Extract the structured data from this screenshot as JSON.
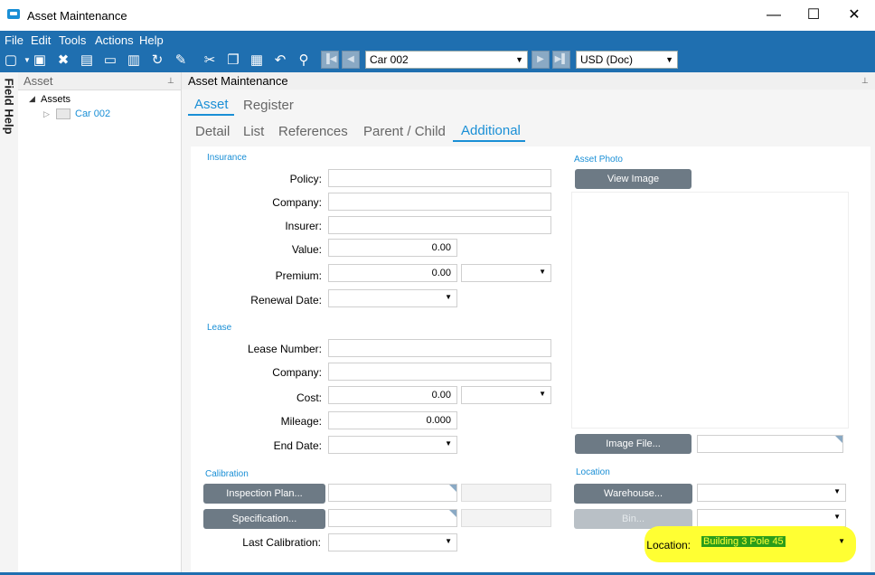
{
  "window": {
    "title": "Asset Maintenance",
    "minimize": "—",
    "maximize": "☐",
    "close": "✕"
  },
  "menu": [
    "File",
    "Edit",
    "Tools",
    "Actions",
    "Help"
  ],
  "toolbar": {
    "record_combo": "Car 002",
    "currency_combo": "USD (Doc)"
  },
  "sidebar": {
    "label": "Field Help"
  },
  "tree": {
    "header": "Asset",
    "root": "Assets",
    "child": "Car 002"
  },
  "main": {
    "header": "Asset Maintenance",
    "top_tabs": [
      "Asset",
      "Register"
    ],
    "sub_tabs": [
      "Detail",
      "List",
      "References",
      "Parent / Child",
      "Additional"
    ]
  },
  "insurance": {
    "section": "Insurance",
    "policy_label": "Policy:",
    "company_label": "Company:",
    "insurer_label": "Insurer:",
    "value_label": "Value:",
    "value": "0.00",
    "premium_label": "Premium:",
    "premium": "0.00",
    "renewal_label": "Renewal Date:"
  },
  "lease": {
    "section": "Lease",
    "number_label": "Lease Number:",
    "company_label": "Company:",
    "cost_label": "Cost:",
    "cost": "0.00",
    "mileage_label": "Mileage:",
    "mileage": "0.000",
    "end_label": "End Date:"
  },
  "calibration": {
    "section": "Calibration",
    "inspection_button": "Inspection Plan...",
    "specification_button": "Specification...",
    "last_label": "Last Calibration:"
  },
  "photo": {
    "section": "Asset Photo",
    "view_button": "View Image",
    "image_file_button": "Image File..."
  },
  "location": {
    "section": "Location",
    "warehouse_button": "Warehouse...",
    "bin_button": "Bin...",
    "location_label": "Location:",
    "location_value": "Building 3 Pole 45"
  },
  "colors": {
    "accent": "#1a8fd6",
    "toolbar": "#1f6fb0",
    "highlight": "#ffff33"
  }
}
